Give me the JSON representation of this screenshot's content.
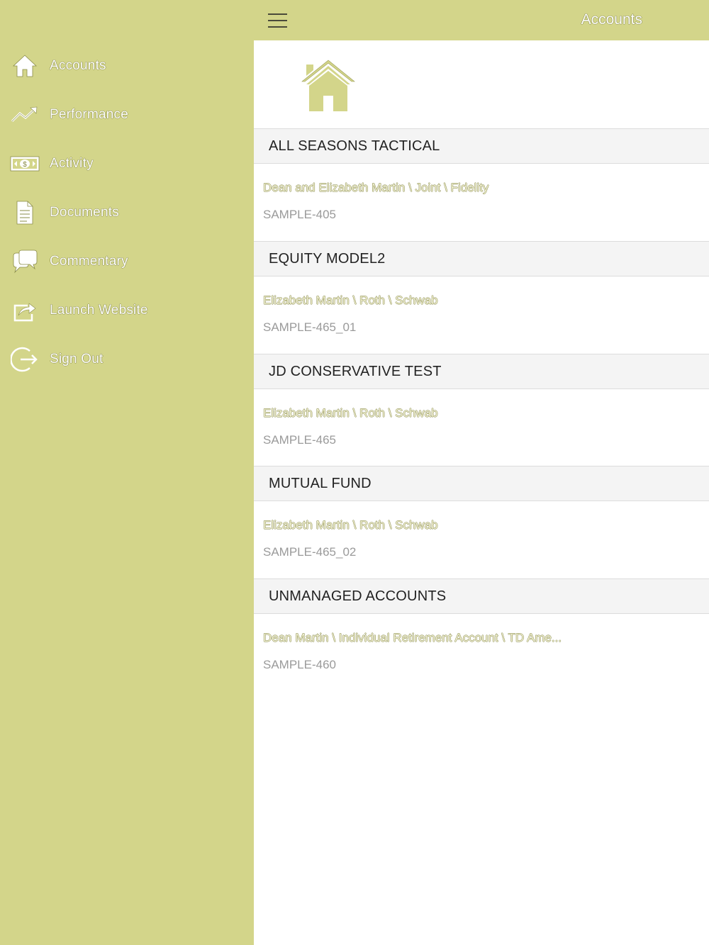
{
  "header": {
    "title": "Accounts"
  },
  "sidebar": {
    "items": [
      {
        "label": "Accounts",
        "icon": "home-icon"
      },
      {
        "label": "Performance",
        "icon": "trend-icon"
      },
      {
        "label": "Activity",
        "icon": "money-icon"
      },
      {
        "label": "Documents",
        "icon": "document-icon"
      },
      {
        "label": "Commentary",
        "icon": "chat-icon"
      },
      {
        "label": "Launch Website",
        "icon": "share-icon"
      },
      {
        "label": "Sign Out",
        "icon": "sign-out-icon"
      }
    ]
  },
  "accounts": [
    {
      "group": "ALL SEASONS TACTICAL",
      "name": "Dean and Elizabeth Martin \\ Joint \\ Fidelity",
      "id": "SAMPLE-405"
    },
    {
      "group": "EQUITY MODEL2",
      "name": "Elizabeth Martin \\ Roth \\ Schwab",
      "id": "SAMPLE-465_01"
    },
    {
      "group": "JD CONSERVATIVE TEST",
      "name": "Elizabeth Martin \\ Roth \\ Schwab",
      "id": "SAMPLE-465"
    },
    {
      "group": "MUTUAL FUND",
      "name": "Elizabeth Martin \\ Roth \\ Schwab",
      "id": "SAMPLE-465_02"
    },
    {
      "group": "UNMANAGED ACCOUNTS",
      "name": "Dean Martin \\ Individual Retirement Account \\ TD Ame...",
      "id": "SAMPLE-460"
    }
  ],
  "colors": {
    "accent": "#d3d58a",
    "header_bg": "#f4f4f4",
    "id_text": "#9a9a9a"
  }
}
